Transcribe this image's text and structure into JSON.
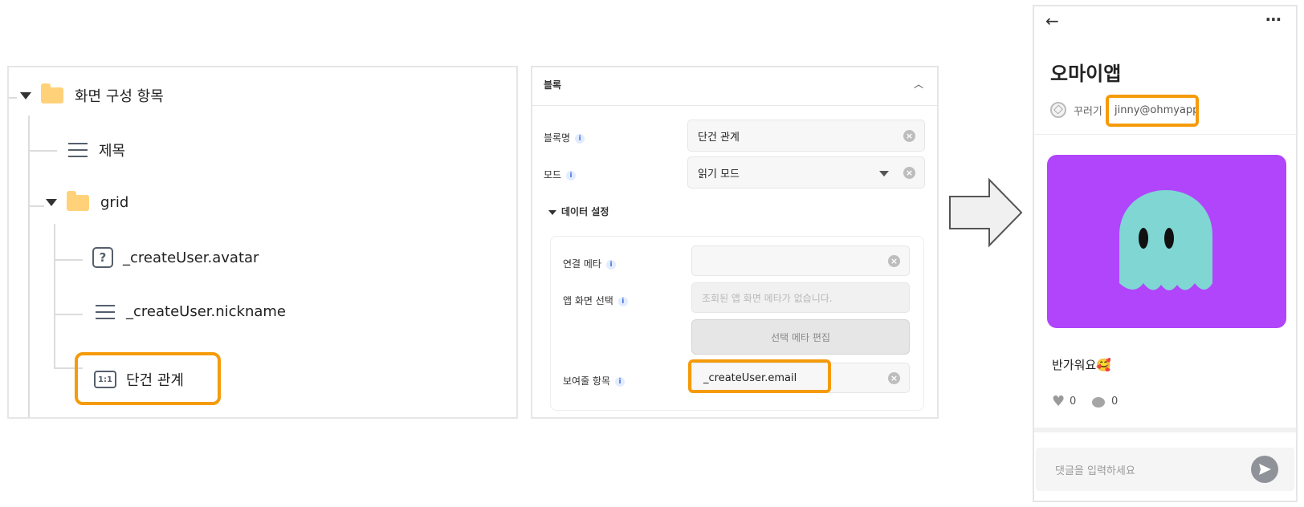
{
  "tree": {
    "root": "화면 구성 항목",
    "title_item": "제목",
    "grid": "grid",
    "avatar": "_createUser.avatar",
    "nickname": "_createUser.nickname",
    "single": "단건 관계",
    "ratio_icon_text": "1:1",
    "question_icon_text": "?"
  },
  "panel": {
    "header": "블록",
    "block_name_label": "블록명",
    "block_name_value": "단건 관계",
    "mode_label": "모드",
    "mode_value": "읽기 모드",
    "data_section": "데이터 설정",
    "linked_meta_label": "연결 메타",
    "app_screen_label": "앱 화면 선택",
    "app_screen_placeholder": "조회된 앱 화면 메타가 없습니다.",
    "edit_button": "선택 메타 편집",
    "display_label": "보여줄 항목",
    "display_value": "_createUser.email",
    "info_glyph": "i"
  },
  "phone": {
    "back": "←",
    "more": "⋯",
    "title": "오마이앱",
    "author_label": "꾸러기",
    "author_email": "jinny@ohmyapp",
    "post_text": "반가워요🥰",
    "likes": "0",
    "comments": "0",
    "comment_placeholder": "댓글을 입력하세요"
  },
  "colors": {
    "highlight": "#f59b0b",
    "image_bg": "#b045fb",
    "ghost": "#7fd6d3",
    "folder": "#ffd27a"
  }
}
